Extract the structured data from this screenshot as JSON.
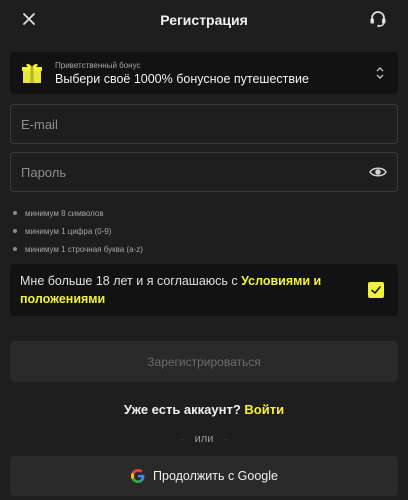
{
  "header": {
    "title": "Регистрация",
    "close_icon": "close-icon",
    "support_icon": "headset-icon"
  },
  "bonus": {
    "label": "Приветственный бонус",
    "value": "Выбери своё 1000% бонусное путешествие",
    "icon": "gift-icon",
    "chevron_icon": "chevron-up-down-icon"
  },
  "form": {
    "email_placeholder": "E-mail",
    "email_value": "",
    "password_placeholder": "Пароль",
    "password_value": "",
    "eye_icon": "eye-icon"
  },
  "password_rules": [
    "минимум 8 символов",
    "минимум 1 цифра (0-9)",
    "минимум 1 строчная буква (a-z)"
  ],
  "consent": {
    "text_before": "Мне больше 18 лет и я соглашаюсь с ",
    "link_text": "Условиями и положениями",
    "checked": true
  },
  "register_button": "Зарегистрироваться",
  "login": {
    "question": "Уже есть аккаунт? ",
    "link": "Войти"
  },
  "divider_text": "или",
  "google_button": "Продолжить с Google",
  "colors": {
    "accent": "#f2f23a",
    "background": "#1e1e1e",
    "panel": "#121212"
  }
}
